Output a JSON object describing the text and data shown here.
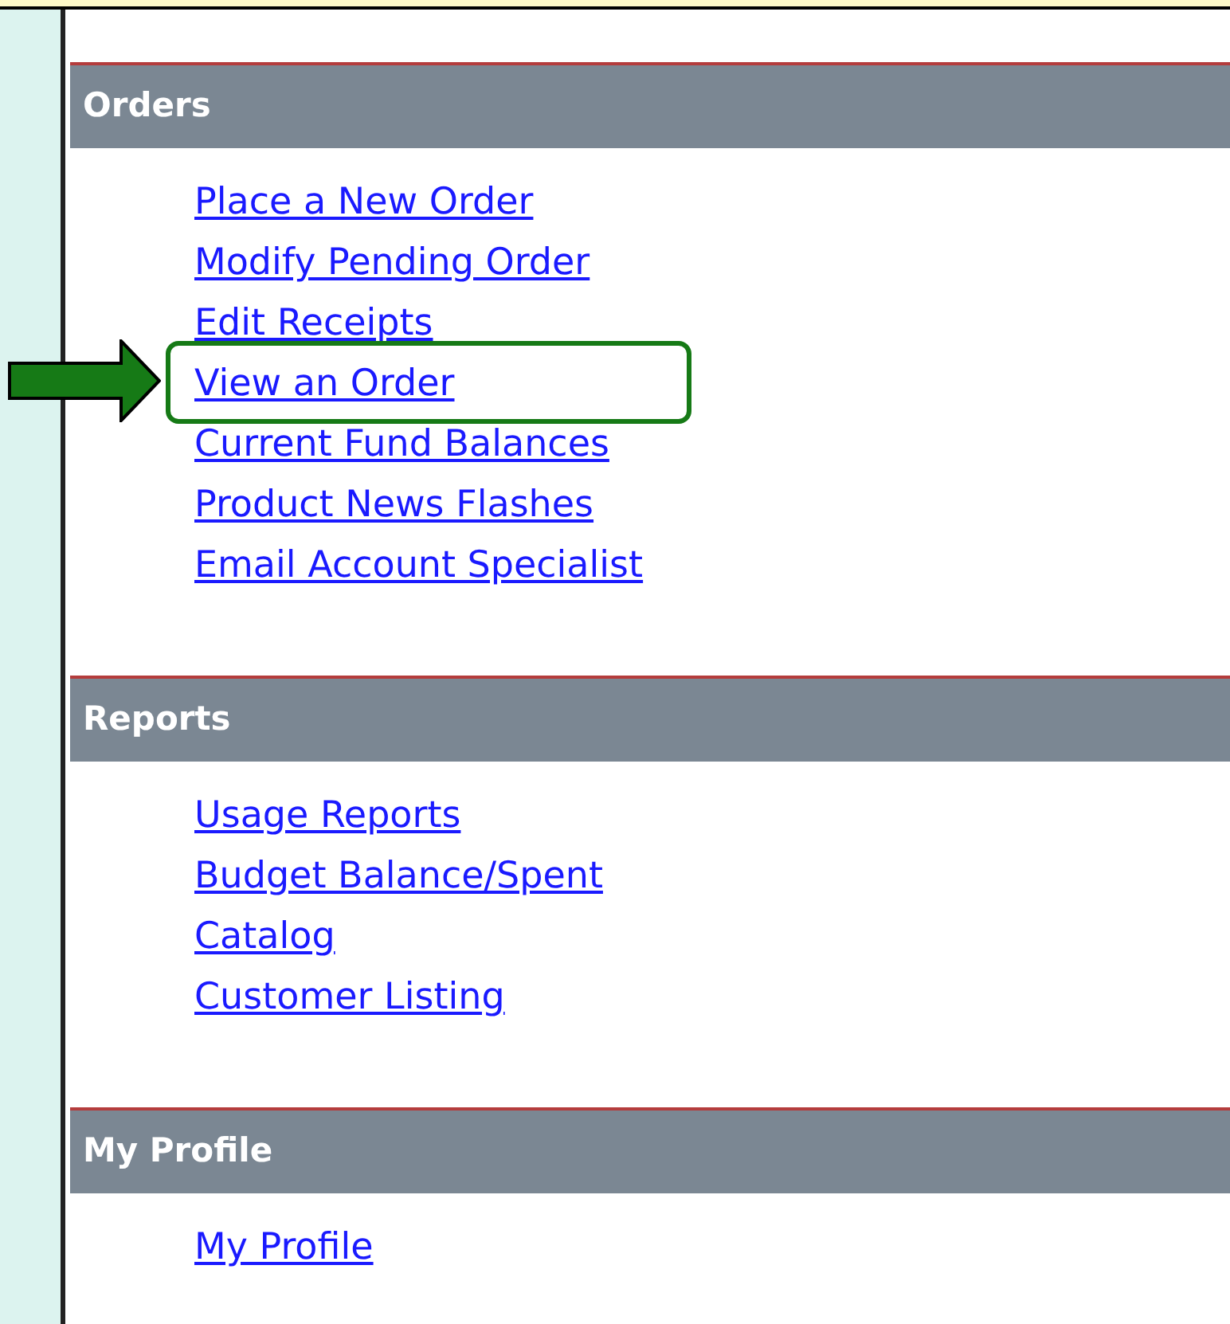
{
  "sections": [
    {
      "title": "Orders",
      "links": [
        {
          "label": "Place a New Order",
          "highlighted": false
        },
        {
          "label": "Modify Pending Order",
          "highlighted": false
        },
        {
          "label": "Edit Receipts",
          "highlighted": false
        },
        {
          "label": "View an Order",
          "highlighted": true
        },
        {
          "label": "Current Fund Balances",
          "highlighted": false
        },
        {
          "label": "Product News Flashes",
          "highlighted": false
        },
        {
          "label": "Email Account Specialist",
          "highlighted": false
        }
      ]
    },
    {
      "title": "Reports",
      "links": [
        {
          "label": "Usage Reports",
          "highlighted": false
        },
        {
          "label": "Budget Balance/Spent",
          "highlighted": false
        },
        {
          "label": "Catalog",
          "highlighted": false
        },
        {
          "label": "Customer Listing",
          "highlighted": false
        }
      ]
    },
    {
      "title": "My Profile",
      "links": [
        {
          "label": "My Profile",
          "highlighted": false
        }
      ]
    }
  ]
}
